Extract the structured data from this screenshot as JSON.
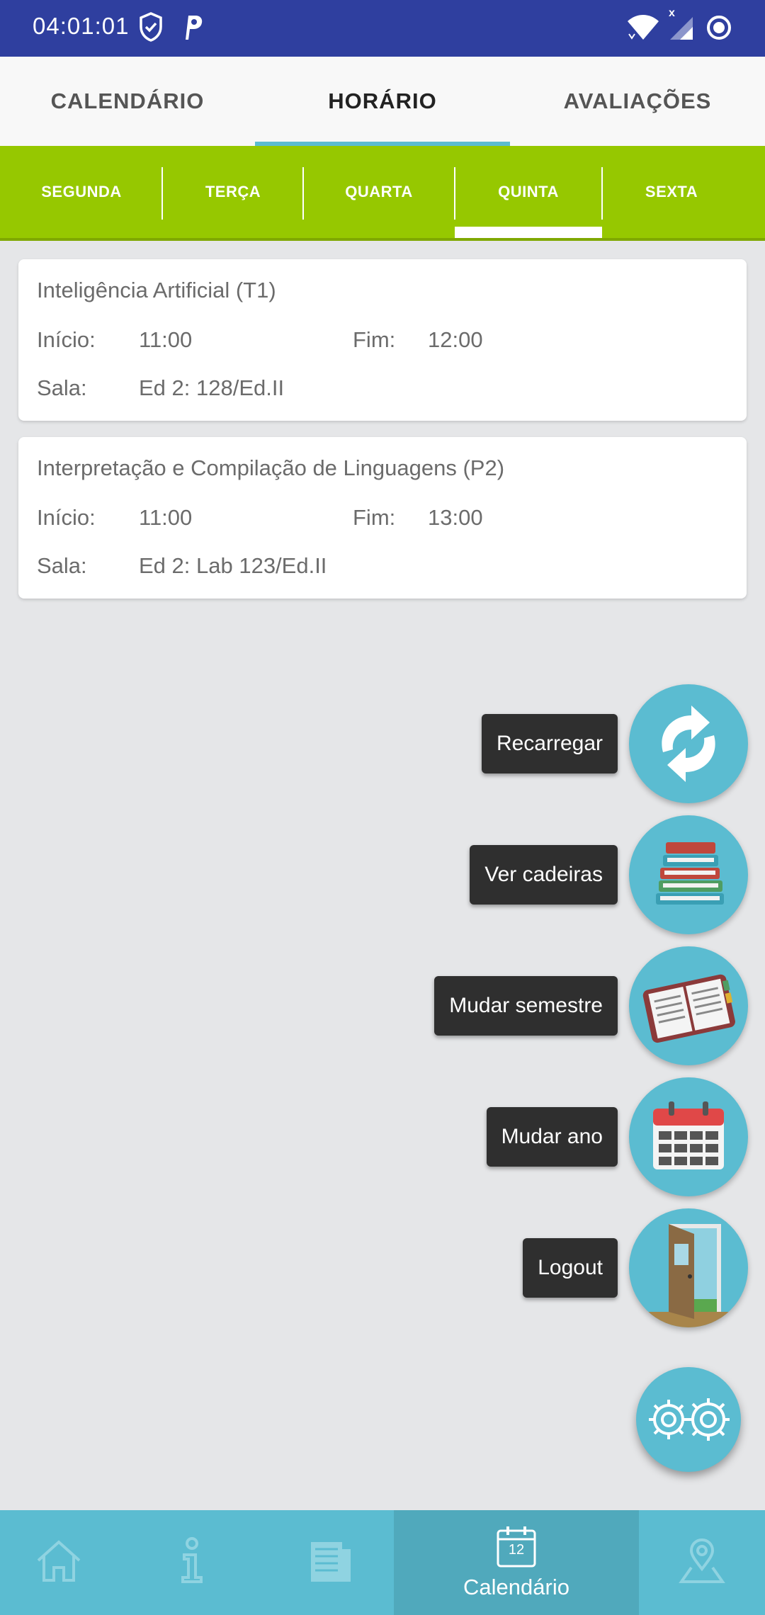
{
  "status_bar": {
    "time": "04:01:01",
    "net_badge": "x"
  },
  "top_tabs": [
    {
      "label": "CALENDÁRIO"
    },
    {
      "label": "HORÁRIO"
    },
    {
      "label": "AVALIAÇÕES"
    }
  ],
  "day_tabs": [
    {
      "label": "SEGUNDA"
    },
    {
      "label": "TERÇA"
    },
    {
      "label": "QUARTA"
    },
    {
      "label": "QUINTA"
    },
    {
      "label": "SEXTA"
    }
  ],
  "selected_day": "QUINTA",
  "labels": {
    "start": "Início:",
    "end": "Fim:",
    "room": "Sala:"
  },
  "classes": [
    {
      "title": "Inteligência Artificial (T1)",
      "start": "11:00",
      "end": "12:00",
      "room": "Ed 2: 128/Ed.II"
    },
    {
      "title": "Interpretação e Compilação de Linguagens (P2)",
      "start": "11:00",
      "end": "13:00",
      "room": "Ed 2: Lab 123/Ed.II"
    }
  ],
  "fab_menu": [
    {
      "label": "Recarregar",
      "icon": "refresh-icon"
    },
    {
      "label": "Ver cadeiras",
      "icon": "books-icon"
    },
    {
      "label": "Mudar semestre",
      "icon": "planner-icon"
    },
    {
      "label": "Mudar ano",
      "icon": "calendar-icon"
    },
    {
      "label": "Logout",
      "icon": "door-icon"
    }
  ],
  "fab_main_icon": "gears-icon",
  "bottom_nav": {
    "items": [
      {
        "icon": "home-icon"
      },
      {
        "icon": "info-icon"
      },
      {
        "icon": "news-icon"
      },
      {
        "icon": "calendar-icon",
        "label": "Calendário",
        "badge": "12"
      },
      {
        "icon": "map-pin-icon"
      }
    ]
  },
  "colors": {
    "status_bar": "#2f3f9f",
    "accent": "#5bbcd1",
    "day_bar": "#96c800",
    "tooltip": "#2f2f2f"
  }
}
